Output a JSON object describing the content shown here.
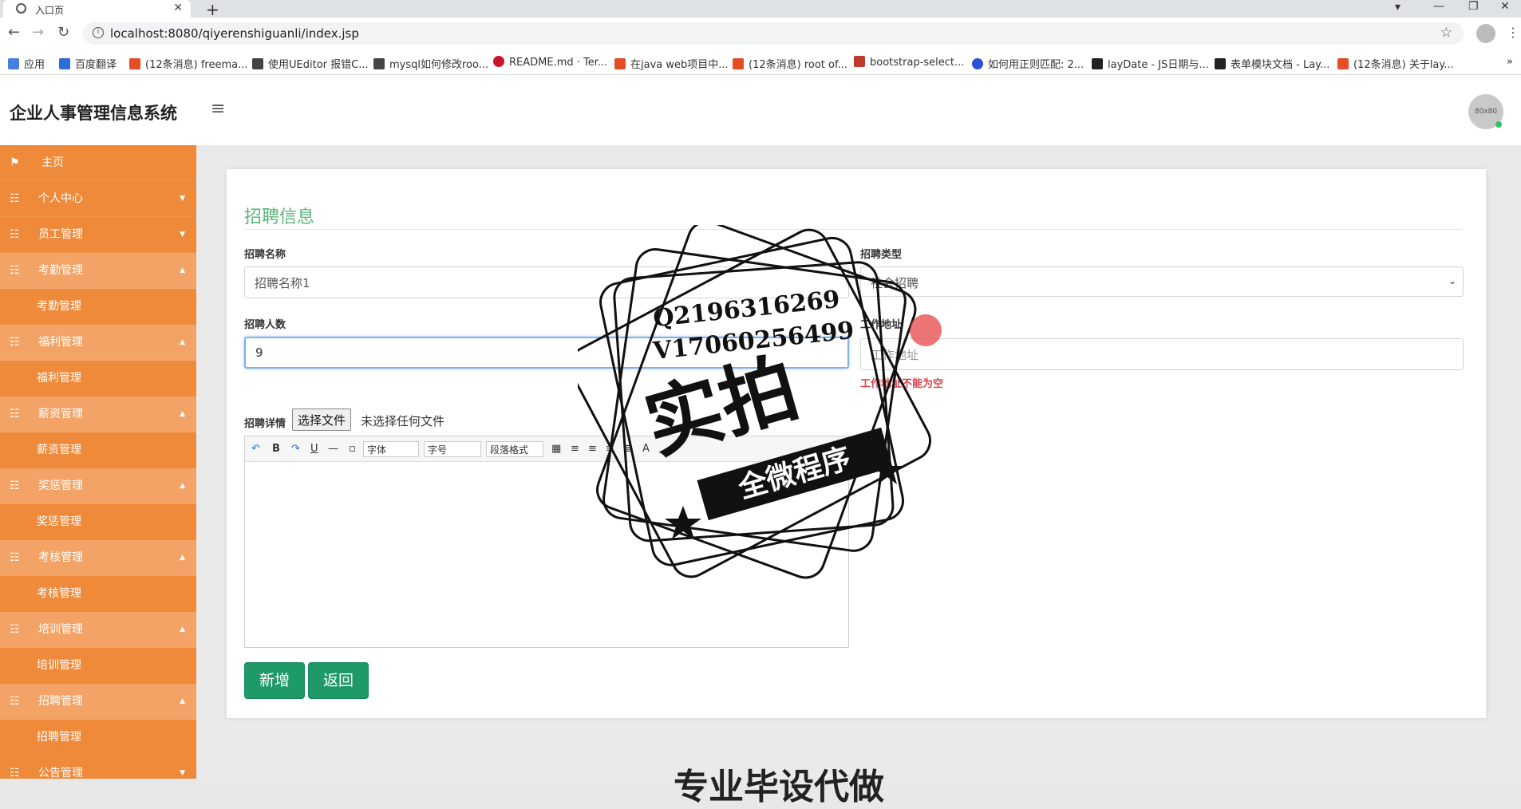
{
  "browser": {
    "tab_title": "入口页",
    "url": "localhost:8080/qiyerenshiguanli/index.jsp",
    "bookmarks": [
      "应用",
      "百度翻译",
      "(12条消息) freema...",
      "使用UEditor 报错C...",
      "mysql如何修改roo...",
      "README.md · Ter...",
      "在java web项目中...",
      "(12条消息) root of...",
      "bootstrap-select...",
      "如何用正则匹配: 2...",
      "layDate - JS日期与...",
      "表单模块文档 - Lay...",
      "(12条消息) 关于lay..."
    ]
  },
  "app": {
    "title": "企业人事管理信息系统",
    "avatar_text": "80x80"
  },
  "sidebar": {
    "home": "主页",
    "groups": [
      {
        "label": "个人中心",
        "open": false
      },
      {
        "label": "员工管理",
        "open": false
      },
      {
        "label": "考勤管理",
        "open": true,
        "sub": "考勤管理"
      },
      {
        "label": "福利管理",
        "open": true,
        "sub": "福利管理"
      },
      {
        "label": "薪资管理",
        "open": true,
        "sub": "薪资管理"
      },
      {
        "label": "奖惩管理",
        "open": true,
        "sub": "奖惩管理"
      },
      {
        "label": "考核管理",
        "open": true,
        "sub": "考核管理"
      },
      {
        "label": "培训管理",
        "open": true,
        "sub": "培训管理"
      },
      {
        "label": "招聘管理",
        "open": true,
        "sub": "招聘管理"
      },
      {
        "label": "公告管理",
        "open": false
      }
    ]
  },
  "form": {
    "title": "招聘信息",
    "name_label": "招聘名称",
    "name_value": "招聘名称1",
    "type_label": "招聘类型",
    "type_value": "社会招聘",
    "count_label": "招聘人数",
    "count_value": "9",
    "addr_label": "工作地址",
    "addr_placeholder": "工作地址",
    "addr_error": "工作地址不能为空",
    "detail_label": "招聘详情",
    "file_button": "选择文件",
    "file_status": "未选择任何文件",
    "editor_font": "字体",
    "editor_size": "字号",
    "editor_para": "段落格式",
    "submit": "新增",
    "back": "返回"
  },
  "watermark": {
    "line1": "Q2196316269",
    "line2": "V17060256499",
    "big": "实拍",
    "ribbon": "全微程序"
  },
  "footer_slogan": "专业毕设代做"
}
